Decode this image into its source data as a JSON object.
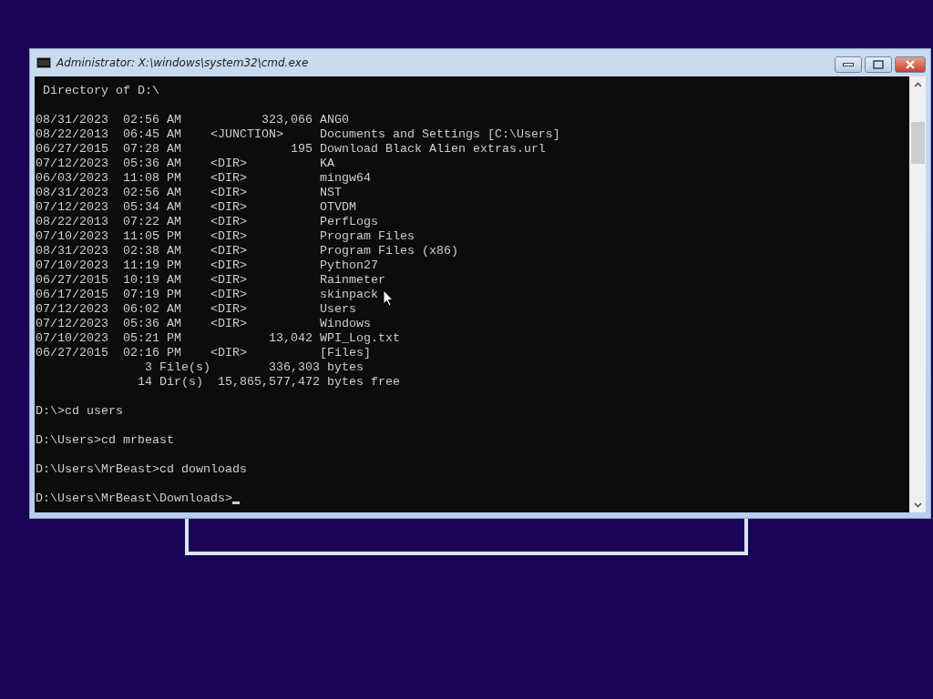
{
  "window": {
    "title": "Administrator: X:\\windows\\system32\\cmd.exe"
  },
  "console": {
    "blocks": [
      [
        " Directory of D:\\"
      ],
      [
        "08/31/2023  02:56 AM           323,066 ANG0",
        "08/22/2013  06:45 AM    <JUNCTION>     Documents and Settings [C:\\Users]",
        "06/27/2015  07:28 AM               195 Download Black Alien extras.url",
        "07/12/2023  05:36 AM    <DIR>          KA",
        "06/03/2023  11:08 PM    <DIR>          mingw64",
        "08/31/2023  02:56 AM    <DIR>          NST",
        "07/12/2023  05:34 AM    <DIR>          OTVDM",
        "08/22/2013  07:22 AM    <DIR>          PerfLogs",
        "07/10/2023  11:05 PM    <DIR>          Program Files",
        "08/31/2023  02:38 AM    <DIR>          Program Files (x86)",
        "07/10/2023  11:19 PM    <DIR>          Python27",
        "06/27/2015  10:19 AM    <DIR>          Rainmeter",
        "06/17/2015  07:19 PM    <DIR>          skinpack",
        "07/12/2023  06:02 AM    <DIR>          Users",
        "07/12/2023  05:36 AM    <DIR>          Windows",
        "07/10/2023  05:21 PM            13,042 WPI_Log.txt",
        "06/27/2015  02:16 PM    <DIR>          [Files]",
        "               3 File(s)        336,303 bytes",
        "              14 Dir(s)  15,865,577,472 bytes free"
      ],
      [
        "D:\\>cd users"
      ],
      [
        "D:\\Users>cd mrbeast"
      ],
      [
        "D:\\Users\\MrBeast>cd downloads"
      ]
    ],
    "prompt": {
      "text": "D:\\Users\\MrBeast\\Downloads>",
      "cursor": true
    }
  }
}
